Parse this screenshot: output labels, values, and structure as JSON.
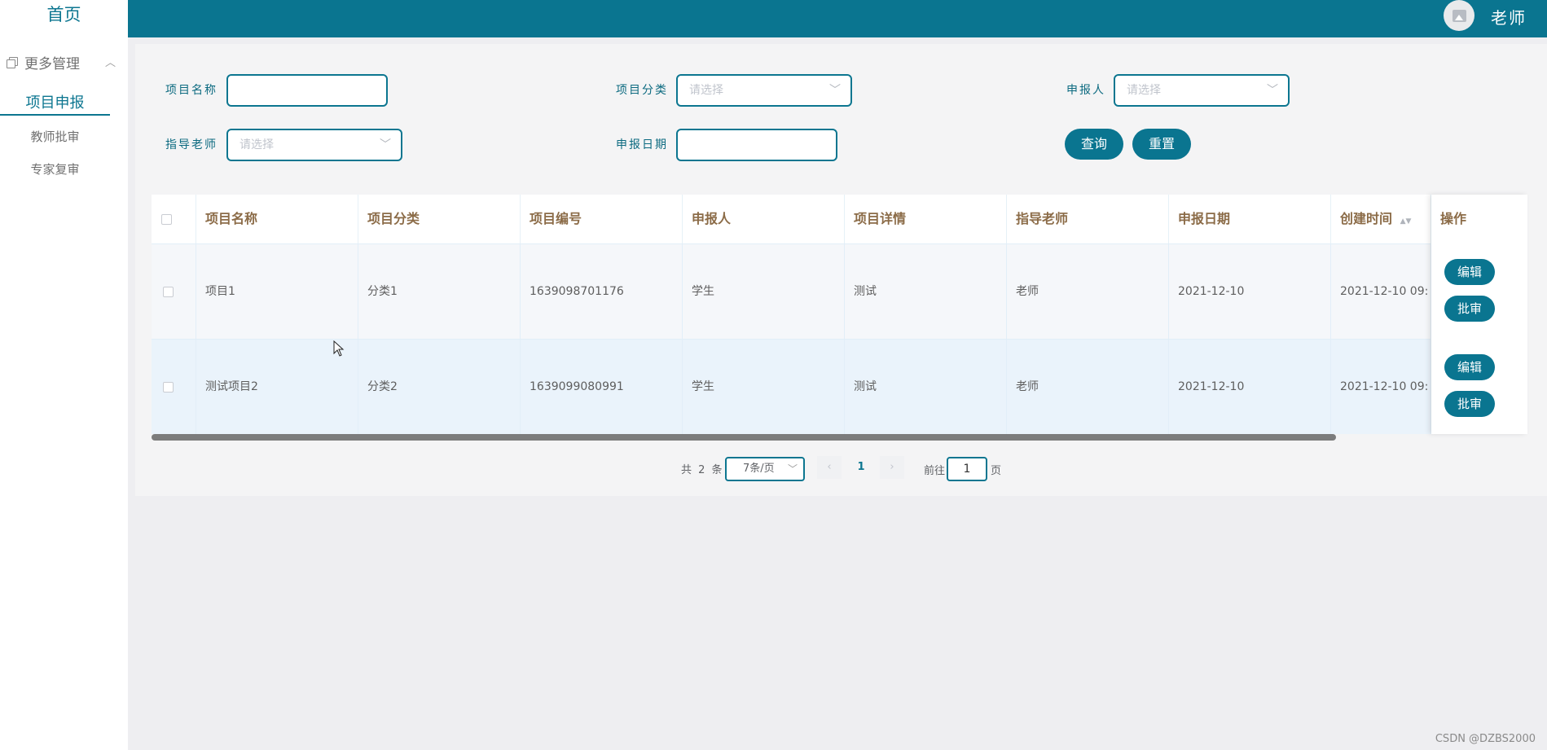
{
  "sidebar": {
    "home": "首页",
    "group_label": "更多管理",
    "items": [
      {
        "label": "项目申报",
        "active": true
      },
      {
        "label": "教师批审",
        "active": false
      },
      {
        "label": "专家复审",
        "active": false
      }
    ]
  },
  "header": {
    "username": "老师"
  },
  "filters": {
    "project_name_label": "项目名称",
    "project_name_value": "",
    "category_label": "项目分类",
    "category_placeholder": "请选择",
    "applicant_label": "申报人",
    "applicant_placeholder": "请选择",
    "advisor_label": "指导老师",
    "advisor_placeholder": "请选择",
    "date_label": "申报日期",
    "date_value": "",
    "query_button": "查询",
    "reset_button": "重置"
  },
  "table": {
    "columns": [
      "项目名称",
      "项目分类",
      "项目编号",
      "申报人",
      "项目详情",
      "指导老师",
      "申报日期",
      "创建时间",
      "操作"
    ],
    "rows": [
      {
        "name": "项目1",
        "category": "分类1",
        "code": "1639098701176",
        "applicant": "学生",
        "detail": "测试",
        "advisor": "老师",
        "date": "2021-12-10",
        "created": "2021-12-10 09:"
      },
      {
        "name": "测试项目2",
        "category": "分类2",
        "code": "1639099080991",
        "applicant": "学生",
        "detail": "测试",
        "advisor": "老师",
        "date": "2021-12-10",
        "created": "2021-12-10 09:"
      }
    ],
    "edit_button": "编辑",
    "review_button": "批审"
  },
  "pagination": {
    "total_text": "共 2 条",
    "page_size": "7条/页",
    "prev": "‹",
    "current_page": "1",
    "next": "›",
    "goto_prefix": "前往",
    "goto_value": "1",
    "goto_suffix": "页"
  },
  "watermark": "CSDN @DZBS2000",
  "colors": {
    "primary": "#0a7590",
    "header_text": "#8b6b47",
    "page_bg": "#eeeef1"
  }
}
